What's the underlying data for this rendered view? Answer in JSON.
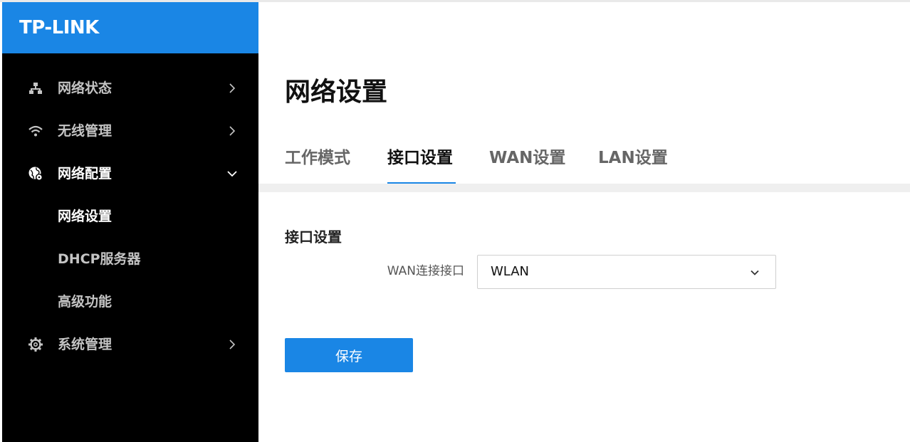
{
  "brand": {
    "logo_text": "TP-LINK",
    "accent_color": "#1a86e5"
  },
  "sidebar": {
    "items": [
      {
        "label": "网络状态",
        "icon": "network-topology-icon",
        "chevron": "chevron-right-icon"
      },
      {
        "label": "无线管理",
        "icon": "wifi-icon",
        "chevron": "chevron-right-icon"
      },
      {
        "label": "网络配置",
        "icon": "globe-gear-icon",
        "chevron": "chevron-down-icon",
        "expanded": true,
        "children": [
          {
            "label": "网络设置",
            "active": true
          },
          {
            "label": "DHCP服务器"
          },
          {
            "label": "高级功能"
          }
        ]
      },
      {
        "label": "系统管理",
        "icon": "gear-icon",
        "chevron": "chevron-right-icon"
      }
    ]
  },
  "main": {
    "page_title": "网络设置",
    "tabs": [
      {
        "label": "工作模式"
      },
      {
        "label": "接口设置",
        "active": true
      },
      {
        "label": "WAN设置"
      },
      {
        "label": "LAN设置"
      }
    ],
    "section_title": "接口设置",
    "form": {
      "wan_interface": {
        "label": "WAN连接接口",
        "value": "WLAN",
        "icon": "chevron-down-icon"
      }
    },
    "save_label": "保存"
  }
}
